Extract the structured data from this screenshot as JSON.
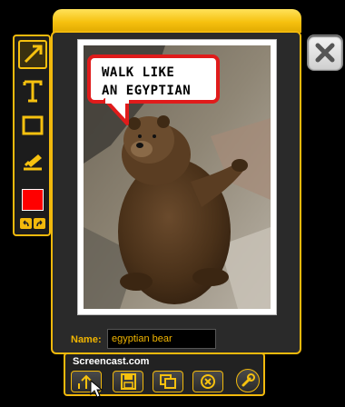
{
  "callout": {
    "text": "WALK LIKE\nAN EGYPTIAN"
  },
  "name_field": {
    "label": "Name:",
    "value": "egyptian bear"
  },
  "bottom_bar": {
    "site_label": "Screencast.com"
  },
  "toolbar": {
    "tools": [
      "arrow-tool",
      "text-tool",
      "rectangle-tool",
      "highlight-tool",
      "color-swatch",
      "undo-redo"
    ],
    "active_tool": "arrow-tool",
    "active_color": "#ff0000"
  },
  "colors": {
    "accent": "#f2b90c",
    "callout_border": "#e01b1b"
  }
}
